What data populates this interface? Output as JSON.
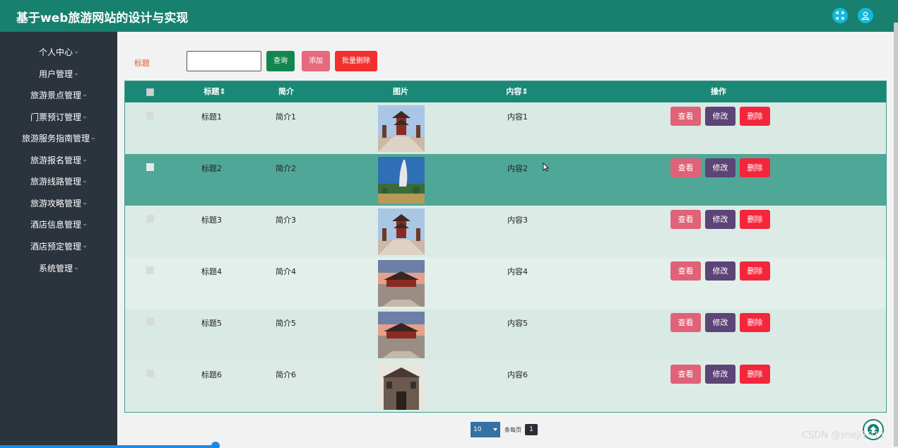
{
  "app": {
    "title": "基于web旅游网站的设计与实现"
  },
  "header": {
    "icons": [
      "fullscreen-icon",
      "user-icon"
    ]
  },
  "sidebar": {
    "items": [
      {
        "label": "个人中心"
      },
      {
        "label": "用户管理"
      },
      {
        "label": "旅游景点管理"
      },
      {
        "label": "门票预订管理"
      },
      {
        "label": "旅游服务指南管理"
      },
      {
        "label": "旅游报名管理"
      },
      {
        "label": "旅游线路管理"
      },
      {
        "label": "旅游攻略管理"
      },
      {
        "label": "酒店信息管理"
      },
      {
        "label": "酒店预定管理"
      },
      {
        "label": "系统管理"
      }
    ]
  },
  "search": {
    "label": "标题",
    "value": "",
    "query_label": "查询",
    "add_label": "添加",
    "bulk_delete_label": "批量删除"
  },
  "table": {
    "columns": [
      "标题",
      "简介",
      "图片",
      "内容",
      "操作"
    ],
    "rows": [
      {
        "title": "标题1",
        "intro": "简介1",
        "content": "内容1",
        "image": "temple-pagoda"
      },
      {
        "title": "标题2",
        "intro": "简介2",
        "content": "内容2",
        "image": "burj-al-arab"
      },
      {
        "title": "标题3",
        "intro": "简介3",
        "content": "内容3",
        "image": "temple-pagoda"
      },
      {
        "title": "标题4",
        "intro": "简介4",
        "content": "内容4",
        "image": "temple-sunset"
      },
      {
        "title": "标题5",
        "intro": "简介5",
        "content": "内容5",
        "image": "temple-sunset"
      },
      {
        "title": "标题6",
        "intro": "简介6",
        "content": "内容6",
        "image": "stone-gate"
      }
    ],
    "actions": {
      "view": "查看",
      "edit": "修改",
      "delete": "删除"
    },
    "hover_row_color": "#4fa797",
    "row_colors": [
      "#d9e9e4",
      "#4fa797",
      "#dcebe6",
      "#e2efea",
      "#d9e9e4",
      "#dcebe6"
    ]
  },
  "pagination": {
    "page_size": "10",
    "per_page_label": "条每页",
    "current_page": "1"
  },
  "watermark": "CSDN @sheji1011",
  "colors": {
    "header": "#17806e",
    "sidebar": "#2b333c",
    "table_header": "#1b8877"
  }
}
